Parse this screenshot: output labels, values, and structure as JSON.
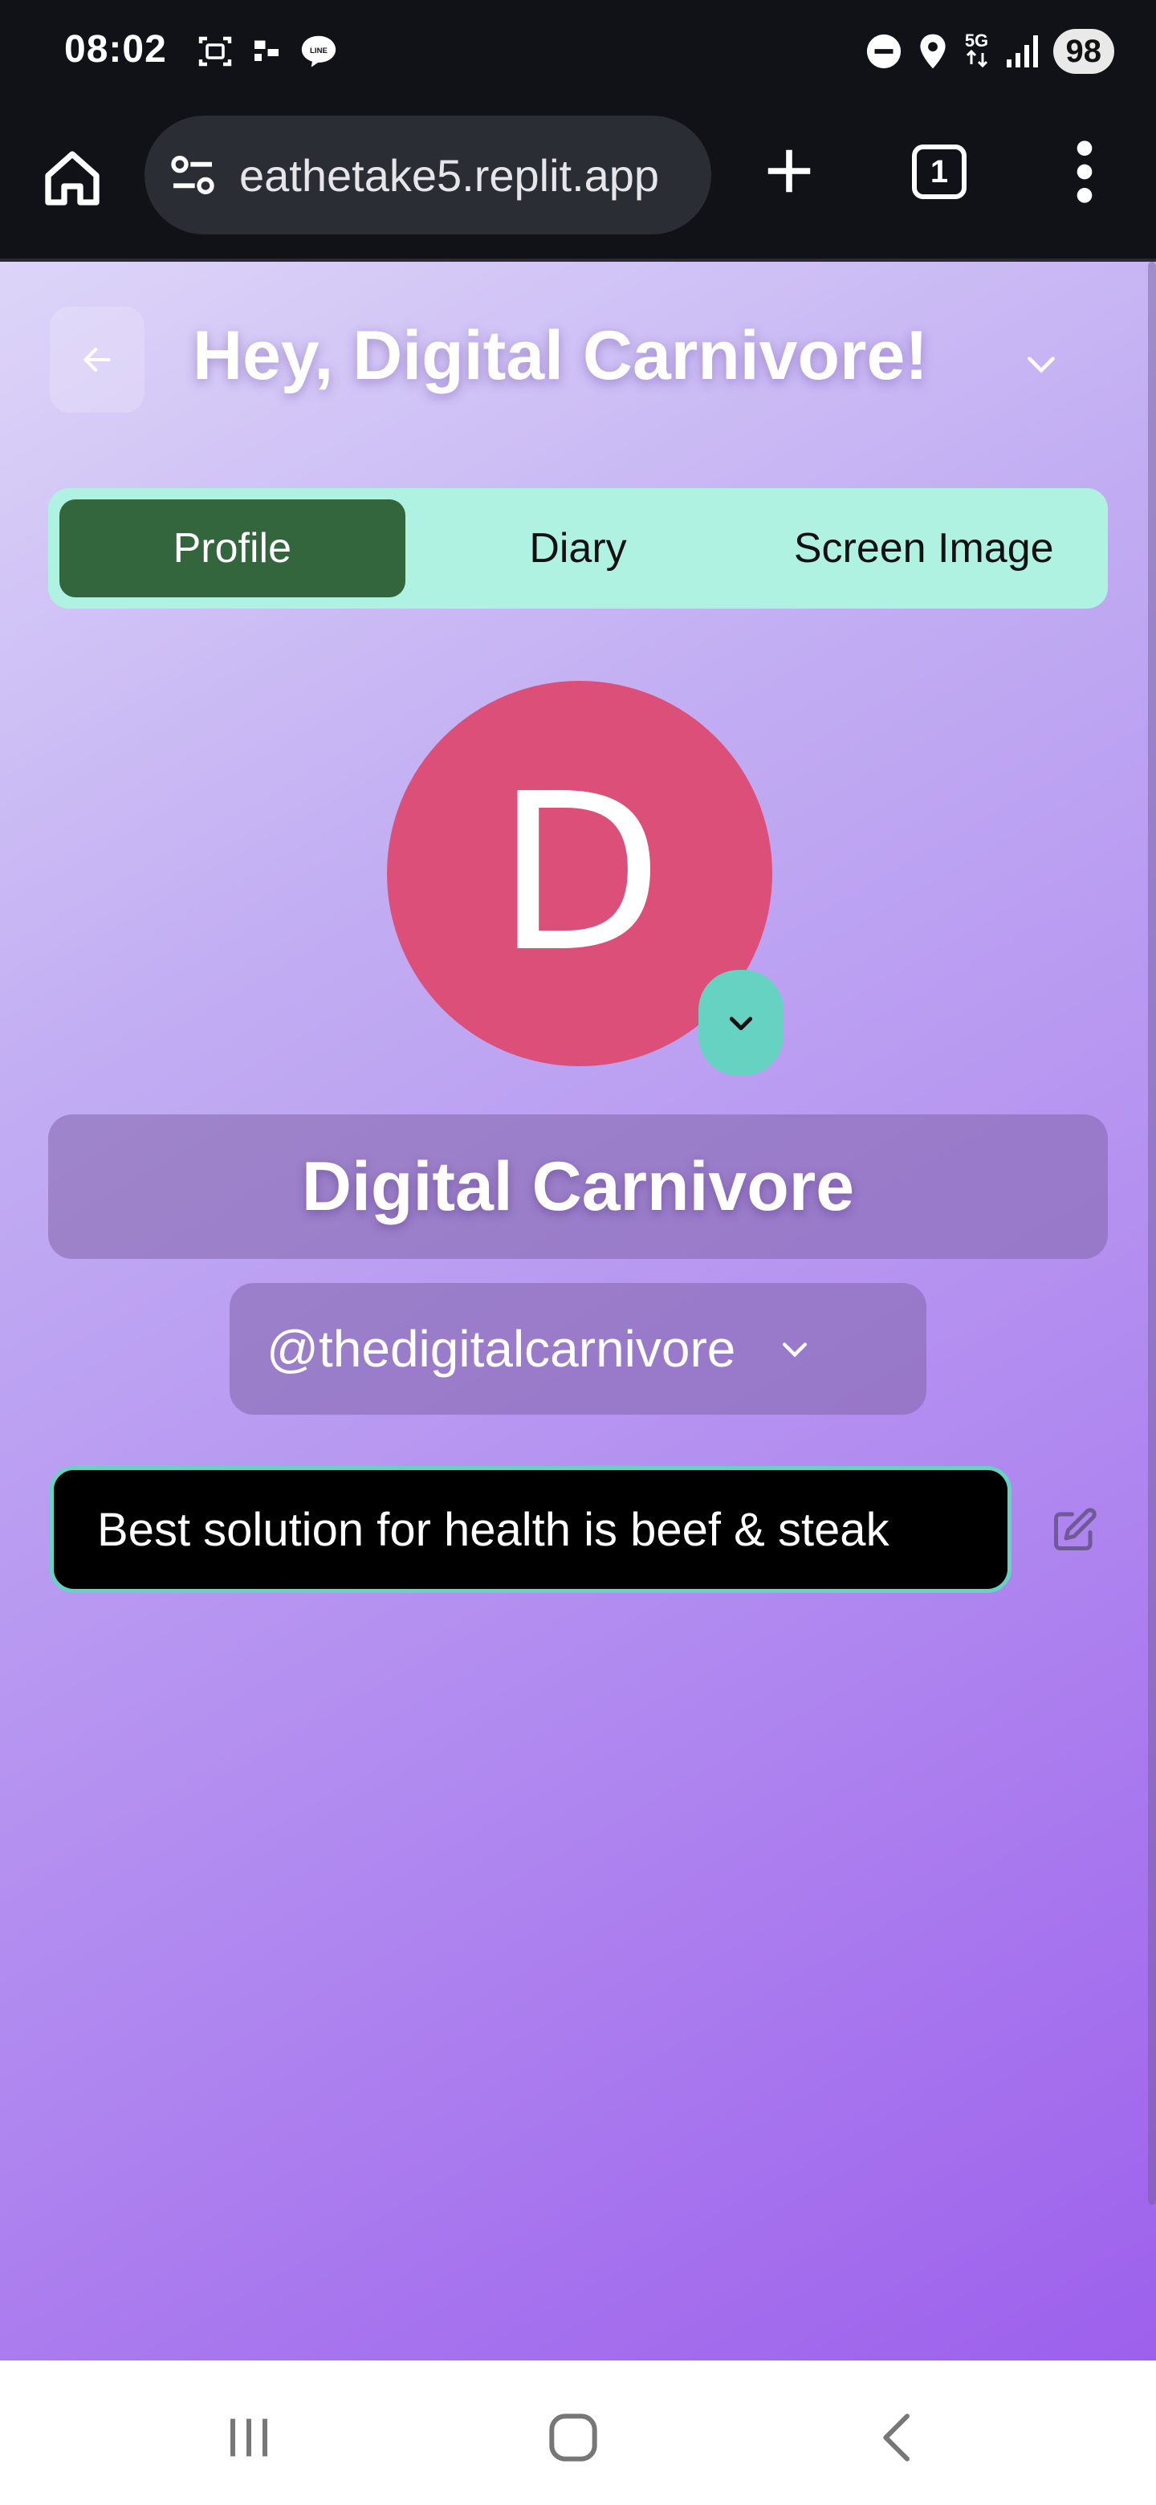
{
  "status_bar": {
    "time": "08:02",
    "network": "5G",
    "battery": "98",
    "icons": [
      "screenshot-icon",
      "cast-icon",
      "line-app-icon",
      "do-not-disturb-icon",
      "location-icon",
      "signal-icon"
    ]
  },
  "browser": {
    "url": "eathetake5.replit.app",
    "tab_count": "1",
    "icons": [
      "home-icon",
      "site-settings-icon",
      "new-tab-icon",
      "tabs-icon",
      "more-vert-icon"
    ]
  },
  "header": {
    "greeting": "Hey, Digital Carnivore!"
  },
  "tabs": [
    {
      "label": "Profile",
      "active": true
    },
    {
      "label": "Diary",
      "active": false
    },
    {
      "label": "Screen Image",
      "active": false
    }
  ],
  "profile": {
    "avatar_letter": "D",
    "avatar_color": "#dc4f78",
    "display_name": "Digital Carnivore",
    "handle": "@thedigitalcarnivore",
    "bio": "Best solution for health is beef & steak"
  },
  "colors": {
    "tab_bar_bg": "#b0f2e2",
    "tab_active_bg": "#33663d",
    "accent_teal": "#66d3c2",
    "gradient_start": "#ddd5f8",
    "gradient_end": "#9d60ec"
  }
}
